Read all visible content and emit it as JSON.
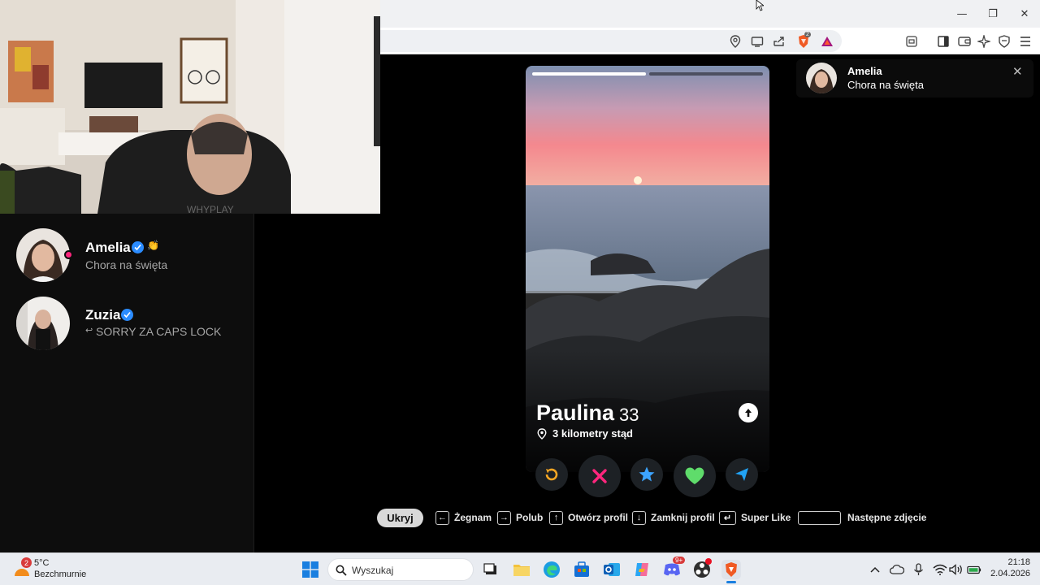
{
  "browser": {
    "window_controls": {
      "minimize": "—",
      "restore": "❐",
      "close": "✕"
    },
    "toolbar_icons": [
      "location-icon",
      "cast-icon",
      "share-icon",
      "brave-shield-icon",
      "brave-rewards-icon",
      "reader-mode-icon",
      "sidebar-icon",
      "wallet-icon",
      "leo-ai-icon",
      "vpn-icon",
      "menu-icon"
    ],
    "shield_badge": "2"
  },
  "sidebar": {
    "matches": [
      {
        "name": "Amelia",
        "message": "Chora na święta",
        "verified": true,
        "online": true,
        "emoji": "👏"
      },
      {
        "name": "Zuzia",
        "message": "SORRY ZA CAPS LOCK",
        "verified": true,
        "reply_arrow": "↩"
      }
    ]
  },
  "card": {
    "name": "Paulina",
    "age": "33",
    "distance": "3 kilometry stąd",
    "photo_count": 2,
    "current_photo": 1
  },
  "actions": {
    "rewind": "↶",
    "nope": "✕",
    "super_like": "★",
    "like": "♥",
    "boost": "➤"
  },
  "shortcuts": {
    "hide": "Ukryj",
    "items": [
      {
        "key": "←",
        "label": "Żegnam"
      },
      {
        "key": "→",
        "label": "Polub"
      },
      {
        "key": "↑",
        "label": "Otwórz profil"
      },
      {
        "key": "↓",
        "label": "Zamknij profil"
      },
      {
        "key": "↵",
        "label": "Super Like"
      },
      {
        "key": "",
        "label": "Następne zdjęcie"
      }
    ]
  },
  "notification": {
    "name": "Amelia",
    "message": "Chora na święta",
    "close": "✕"
  },
  "taskbar": {
    "weather_temp": "5°C",
    "weather_desc": "Bezchmurnie",
    "weather_badge": "2",
    "search_placeholder": "Wyszukaj",
    "discord_badge": "9+",
    "time": "21:18",
    "date": "2.04.2026"
  },
  "colors": {
    "nope": "#fd267d",
    "like": "#29d872",
    "star": "#3ca4ff",
    "rewind": "#f5a623",
    "boost": "#21a3f5",
    "verified": "#2b8cff"
  }
}
